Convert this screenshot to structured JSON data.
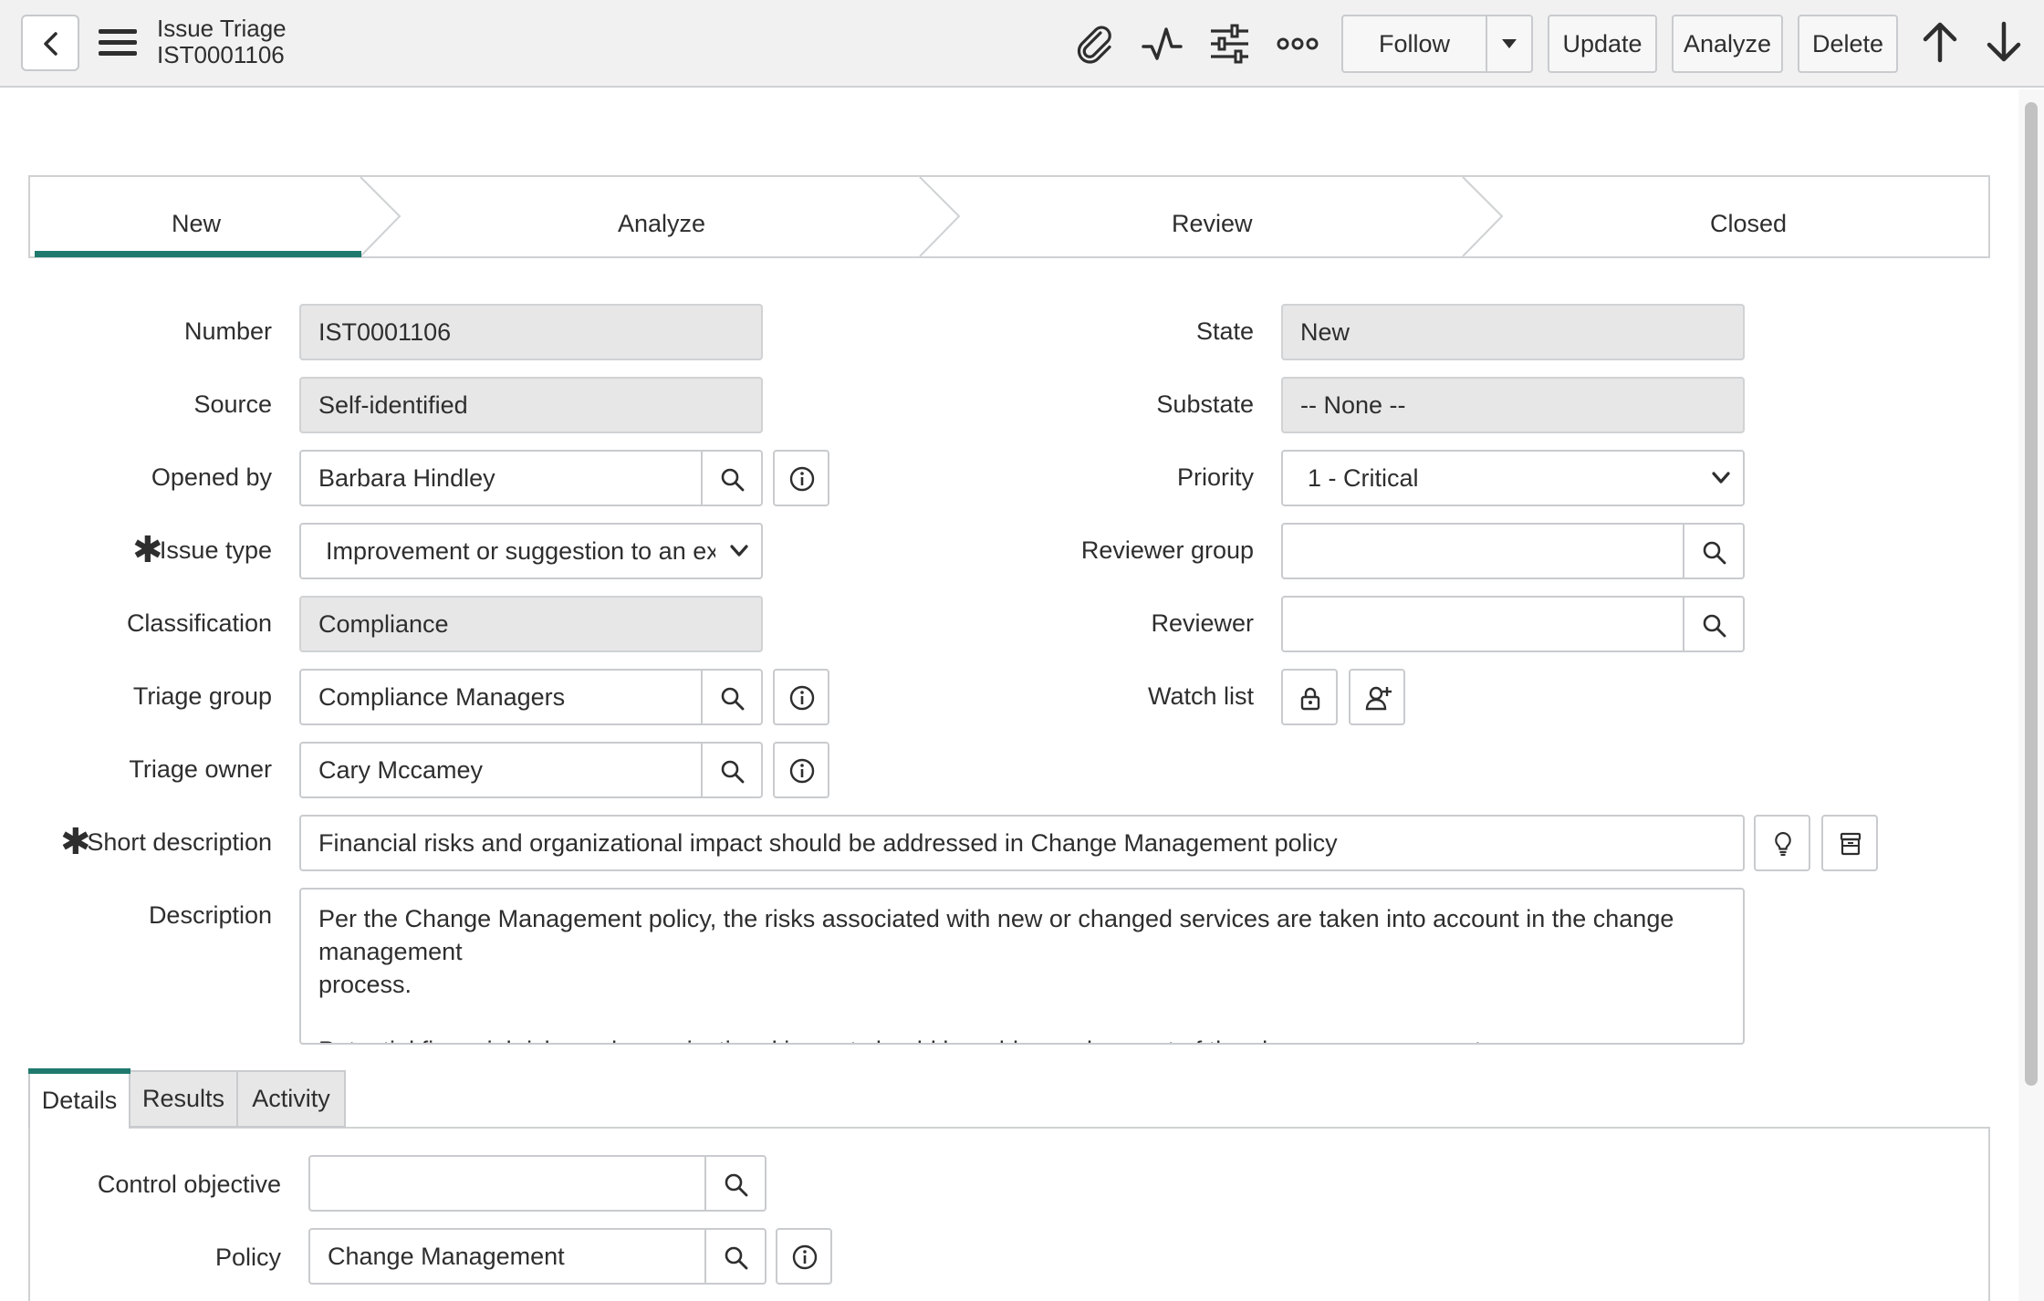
{
  "header": {
    "record_type": "Issue Triage",
    "record_number": "IST0001106",
    "follow_label": "Follow",
    "update_label": "Update",
    "analyze_label": "Analyze",
    "delete_label": "Delete"
  },
  "stages": [
    "New",
    "Analyze",
    "Review",
    "Closed"
  ],
  "form": {
    "number": {
      "label": "Number",
      "value": "IST0001106"
    },
    "source": {
      "label": "Source",
      "value": "Self-identified"
    },
    "opened_by": {
      "label": "Opened by",
      "value": "Barbara Hindley"
    },
    "issue_type": {
      "label": "Issue type",
      "value": "Improvement or suggestion to an existir"
    },
    "classification": {
      "label": "Classification",
      "value": "Compliance"
    },
    "triage_group": {
      "label": "Triage group",
      "value": "Compliance Managers"
    },
    "triage_owner": {
      "label": "Triage owner",
      "value": "Cary Mccamey"
    },
    "state": {
      "label": "State",
      "value": "New"
    },
    "substate": {
      "label": "Substate",
      "value": "-- None --"
    },
    "priority": {
      "label": "Priority",
      "value": "1 - Critical"
    },
    "reviewer_group": {
      "label": "Reviewer group",
      "value": ""
    },
    "reviewer": {
      "label": "Reviewer",
      "value": ""
    },
    "watch_list": {
      "label": "Watch list"
    },
    "short_description": {
      "label": "Short description",
      "value": "Financial risks and organizational impact should be addressed in Change Management policy"
    },
    "description": {
      "label": "Description",
      "line1": "Per the Change Management policy, the risks associated with new or changed services are taken into account in the change management",
      "line2": "process.",
      "line3": "Potential financial risks and organizational impact should be addressed as part of the change management process."
    }
  },
  "tabs": [
    "Details",
    "Results",
    "Activity"
  ],
  "details": {
    "control_objective": {
      "label": "Control objective",
      "value": ""
    },
    "policy": {
      "label": "Policy",
      "value": "Change Management"
    }
  },
  "colors": {
    "accent": "#1f7a6d",
    "readonly_bg": "#e7e7e7",
    "header_bg": "#f1f1f2"
  },
  "icons": [
    "back-icon",
    "menu-icon",
    "attachment-icon",
    "activity-icon",
    "settings-icon",
    "more-icon",
    "chevron-down-icon",
    "arrow-up-icon",
    "arrow-down-icon",
    "search-icon",
    "info-icon",
    "lock-icon",
    "add-user-icon",
    "lightbulb-icon",
    "archive-icon"
  ]
}
